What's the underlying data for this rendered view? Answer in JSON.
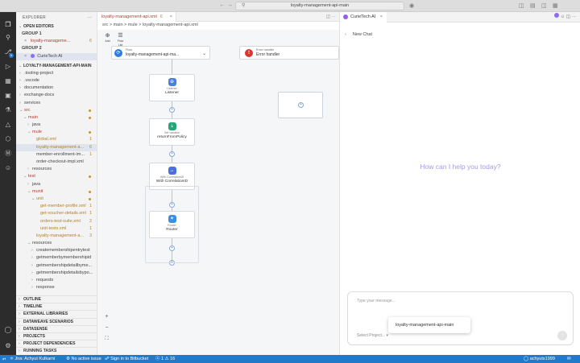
{
  "titlebar": {
    "search": "loyalty-management-api-main"
  },
  "sidebar": {
    "header": "EXPLORER",
    "open_editors_label": "OPEN EDITORS",
    "group1_label": "GROUP 1",
    "group1_file": "loyalty-manageme...",
    "group1_badge": "6",
    "group2_label": "GROUP 2",
    "group2_file": "CurieTech AI",
    "project_label": "LOYALTY-MANAGEMENT-API-MAIN",
    "tree": [
      {
        "label": ".tooling-project",
        "indent": 0,
        "chev": ">"
      },
      {
        "label": ".vscode",
        "indent": 0,
        "chev": ">"
      },
      {
        "label": "documentation",
        "indent": 0,
        "chev": ">"
      },
      {
        "label": "exchange-docs",
        "indent": 0,
        "chev": ">"
      },
      {
        "label": "services",
        "indent": 0,
        "chev": ">"
      },
      {
        "label": "src",
        "indent": 0,
        "chev": "v",
        "cls": "err",
        "dot": true
      },
      {
        "label": "main",
        "indent": 1,
        "chev": "v",
        "cls": "err",
        "dot": true
      },
      {
        "label": "java",
        "indent": 2,
        "chev": ">"
      },
      {
        "label": "mule",
        "indent": 2,
        "chev": "v",
        "cls": "err",
        "dot": true
      },
      {
        "label": "global.xml",
        "indent": 3,
        "chev": "",
        "cls": "mod",
        "badge": "1"
      },
      {
        "label": "loyalty-management-a...",
        "indent": 3,
        "chev": "",
        "cls": "mod",
        "badge": "6",
        "sel": true
      },
      {
        "label": "member-enrollment-im...",
        "indent": 3,
        "chev": "",
        "badge": "1"
      },
      {
        "label": "order-checkout-impl.xml",
        "indent": 3,
        "chev": ""
      },
      {
        "label": "resources",
        "indent": 2,
        "chev": ">"
      },
      {
        "label": "test",
        "indent": 1,
        "chev": "v",
        "cls": "err",
        "dot": true
      },
      {
        "label": "java",
        "indent": 2,
        "chev": ">"
      },
      {
        "label": "munit",
        "indent": 2,
        "chev": "v",
        "cls": "err",
        "dot": true
      },
      {
        "label": "unit",
        "indent": 3,
        "chev": "v",
        "cls": "mod",
        "dot": true
      },
      {
        "label": "get-member-profile.xml",
        "indent": 4,
        "chev": "",
        "cls": "mod",
        "badge": "1"
      },
      {
        "label": "get-voucher-details.xml",
        "indent": 4,
        "chev": "",
        "cls": "mod",
        "badge": "1"
      },
      {
        "label": "orders-test-suite.xml",
        "indent": 4,
        "chev": "",
        "cls": "mod",
        "badge": "2"
      },
      {
        "label": "unit-tests.xml",
        "indent": 4,
        "chev": "",
        "cls": "mod",
        "badge": "1"
      },
      {
        "label": "loyalty-management-a...",
        "indent": 3,
        "chev": "",
        "cls": "mod",
        "badge": "3"
      },
      {
        "label": "resources",
        "indent": 2,
        "chev": "v"
      },
      {
        "label": "createmembershipentrytest",
        "indent": 3,
        "chev": ">"
      },
      {
        "label": "getmemberbymembershipid",
        "indent": 3,
        "chev": ">"
      },
      {
        "label": "getmembershipdetailbyme...",
        "indent": 3,
        "chev": ">"
      },
      {
        "label": "getmembershipdetailsbypo...",
        "indent": 3,
        "chev": ">"
      },
      {
        "label": "requests",
        "indent": 3,
        "chev": ">"
      },
      {
        "label": "response",
        "indent": 3,
        "chev": ">"
      }
    ],
    "bottom_sections": [
      "OUTLINE",
      "TIMELINE",
      "EXTERNAL LIBRARIES",
      "DATAWEAVE SCENARIOS",
      "DATASENSE",
      "PROJECTS",
      "PROJECT DEPENDENCIES",
      "RUNNING TASKS"
    ]
  },
  "editor": {
    "tab_label": "loyalty-management-api.xml",
    "tab_badge": "6",
    "breadcrumb": "src > main > mule > loyalty-management-api.xml",
    "toolbar": {
      "add": "Add",
      "flow_list": "Flow List"
    },
    "flow_type": "Flow",
    "flow_name": "loyalty-management-api-ma...",
    "eh_type": "Error handler",
    "eh_name": "Error handler",
    "nodes": [
      {
        "type": "Listener",
        "name": "Listener",
        "icon": "⊕"
      },
      {
        "type": "Set variable",
        "name": "returnFromPolicy",
        "icon": "⇣"
      },
      {
        "type": "With CorrelationID",
        "name": "With CorrelationID",
        "icon": "↔"
      },
      {
        "type": "Router",
        "name": "Router",
        "icon": "✦"
      }
    ]
  },
  "chat": {
    "tab_label": "CurieTech AI",
    "nav_label": "New Chat",
    "welcome": "How can I help you today?",
    "input_placeholder": "Type your message...",
    "select_project": "Select Project...",
    "project_option": "loyalty-management-api-main"
  },
  "statusbar": {
    "jira": "Jira: Achyut Kulkarni",
    "issue": "No active issue",
    "bitbucket": "Sign in to Bitbucket",
    "problems": "ⓧ 1 ⚠ 16",
    "user": "achyuts1999"
  },
  "colors": {
    "accent": "#2379c9",
    "welcome": "#a89be8",
    "error": "#d8372e",
    "flow": "#2d7ce4"
  }
}
